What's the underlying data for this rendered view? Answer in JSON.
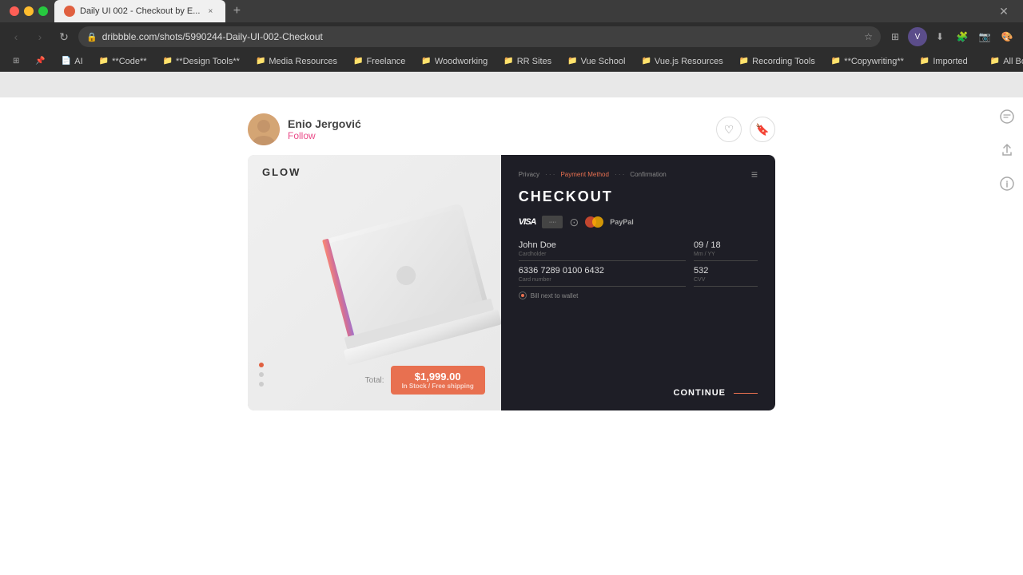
{
  "browser": {
    "tab": {
      "title": "Daily UI 002 - Checkout by E...",
      "favicon": "🔴"
    },
    "address": "dribbble.com/shots/5990244-Daily-UI-002-Checkout",
    "bookmarks": [
      {
        "label": "AI",
        "icon": "📄"
      },
      {
        "label": "**Code**",
        "icon": "📁"
      },
      {
        "label": "**Design Tools**",
        "icon": "📁"
      },
      {
        "label": "Media Resources",
        "icon": "📁"
      },
      {
        "label": "Freelance",
        "icon": "📁"
      },
      {
        "label": "Woodworking",
        "icon": "📁"
      },
      {
        "label": "RR Sites",
        "icon": "📁"
      },
      {
        "label": "Vue School",
        "icon": "📁"
      },
      {
        "label": "Vue.js Resources",
        "icon": "📁"
      },
      {
        "label": "Recording Tools",
        "icon": "📁"
      },
      {
        "label": "**Copywriting**",
        "icon": "📁"
      },
      {
        "label": "Imported",
        "icon": "📁"
      },
      {
        "label": "All Bookmarks",
        "icon": "📁"
      }
    ]
  },
  "shot": {
    "author": {
      "name": "Enio Jergović",
      "follow_label": "Follow"
    },
    "card": {
      "logo": "GLOW",
      "checkout_title": "CHECKOUT",
      "nav_steps": [
        "Privacy",
        "Payment Method",
        "Confirmation"
      ],
      "active_step": "Payment Method",
      "total_label": "Total:",
      "price": "$1,999.00",
      "price_sub": "In Stock / Free shipping",
      "continue_label": "CONTINUE",
      "fields": {
        "name": "John Doe",
        "name_label": "Cardholder",
        "expiry": "09 / 18",
        "expiry_label": "Mm / YY",
        "card_number": "6336 7289 0100 6432",
        "card_number_label": "Card number",
        "cvv": "532",
        "cvv_label": "CVV"
      },
      "save_label": "Bill next to wallet",
      "payment_methods": [
        "VISA",
        "····",
        "⊙",
        "MC",
        "PayPal"
      ]
    }
  },
  "sidebar_icons": {
    "comment": "💬",
    "share": "⬆",
    "info": "ℹ"
  }
}
